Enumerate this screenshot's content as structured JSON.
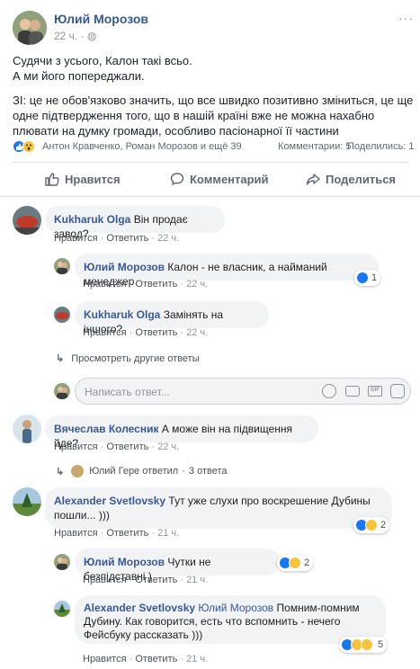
{
  "post": {
    "author": "Юлий Морозов",
    "time": "22 ч.",
    "text_lines": [
      "Судячи з усього, Калон такі всьо.",
      "А ми його попереджали."
    ],
    "text_p2_lines": [
      "ЗІ: це не обов'язково значить, що все швидко позитивно зміниться, це ще",
      "одне підтвердження того, що в нашій країні вже не можна нахабно",
      "плювати на думку громади, особливо пасіонарної її частини"
    ],
    "reactions_names": "Антон Кравченко, Роман Морозов и ещё 39",
    "comments_count": "Комментарии: 5",
    "shares_count": "Поделились: 1"
  },
  "actions": {
    "like": "Нравится",
    "comment": "Комментарий",
    "share": "Поделиться"
  },
  "labels": {
    "like": "Нравится",
    "reply": "Ответить",
    "sep": "·"
  },
  "comments": [
    {
      "author": "Kukharuk Olga",
      "text": "Він продає завод?",
      "time": "22 ч."
    },
    {
      "author": "Юлий Морозов",
      "text": "Калон - не власник, а найманий менеджер",
      "time": "22 ч.",
      "reactions": "1"
    },
    {
      "author": "Kukharuk Olga",
      "text": "Замінять на іншого?",
      "time": "22 ч."
    },
    {
      "author": "Вячеслав Колесник",
      "text": "А може він на підвищення йде?",
      "time": "22 ч."
    },
    {
      "author": "Alexander Svetlovsky",
      "text1": "Тут уже слухи про воскрешение Дубины",
      "text2": "пошли... )))",
      "time": "21 ч.",
      "reactions": "2"
    },
    {
      "author": "Юлий Морозов",
      "text": "Чутки не безпідставні )",
      "time": "21 ч.",
      "reactions": "2"
    },
    {
      "author": "Alexander Svetlovsky",
      "mention": "Юлий Морозов",
      "text1": "Помним-помним",
      "text2": "Дубину. Как говорится, есть что вспомнить - нечего",
      "text3": "Фейсбуку рассказать )))",
      "time": "21 ч.",
      "reactions": "5"
    }
  ],
  "more_replies": "Просмотреть другие ответы",
  "reply_input_placeholder": "Написать ответ...",
  "replied_summary": {
    "name": "Юлий Гере ответил",
    "sep": "·",
    "count": "3 ответа"
  }
}
